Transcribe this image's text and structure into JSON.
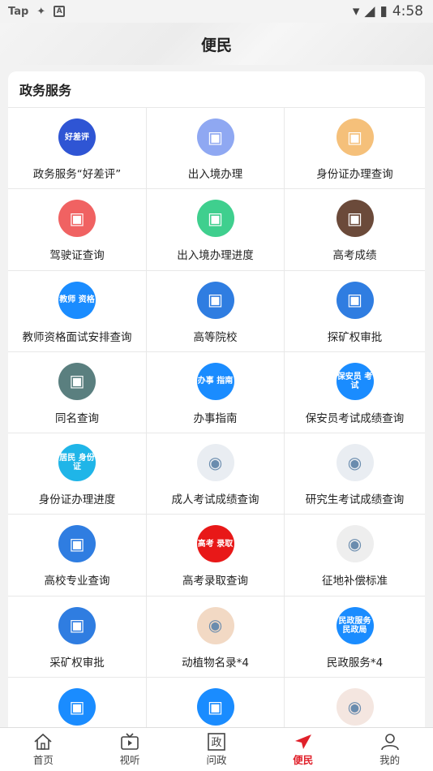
{
  "status_bar": {
    "app_label": "Tap",
    "time": "4:58"
  },
  "header": {
    "title": "便民"
  },
  "section": {
    "title": "政务服务"
  },
  "services": [
    {
      "label": "政务服务“好差评”",
      "icon": "rating-icon",
      "badge": "好差评",
      "color": "#2f55d4"
    },
    {
      "label": "出入境办理",
      "icon": "passport-icon",
      "badge": "",
      "color": "#8fa8f2"
    },
    {
      "label": "身份证办理查询",
      "icon": "id-card-icon",
      "badge": "",
      "color": "#f5c07a"
    },
    {
      "label": "驾驶证查询",
      "icon": "license-icon",
      "badge": "",
      "color": "#f06262"
    },
    {
      "label": "出入境办理进度",
      "icon": "plane-icon",
      "badge": "",
      "color": "#3fcf8e"
    },
    {
      "label": "高考成绩",
      "icon": "exam-score-icon",
      "badge": "",
      "color": "#6b4a3a"
    },
    {
      "label": "教师资格面试安排查询",
      "icon": "teacher-icon",
      "badge": "教师 资格",
      "color": "#1a8cff"
    },
    {
      "label": "高等院校",
      "icon": "university-icon",
      "badge": "",
      "color": "#2f7de1"
    },
    {
      "label": "探矿权审批",
      "icon": "mining-icon",
      "badge": "",
      "color": "#2f7de1"
    },
    {
      "label": "同名查询",
      "icon": "same-name-icon",
      "badge": "",
      "color": "#5a7f7f"
    },
    {
      "label": "办事指南",
      "icon": "guide-icon",
      "badge": "办事 指南",
      "color": "#1a8cff"
    },
    {
      "label": "保安员考试成绩查询",
      "icon": "security-guard-icon",
      "badge": "保安员 考试",
      "color": "#1a8cff"
    },
    {
      "label": "身份证办理进度",
      "icon": "id-progress-icon",
      "badge": "居民 身份证",
      "color": "#1fb5e8"
    },
    {
      "label": "成人考试成绩查询",
      "icon": "adult-exam-icon",
      "badge": "",
      "color": "#e9edf2"
    },
    {
      "label": "研究生考试成绩查询",
      "icon": "graduate-exam-icon",
      "badge": "",
      "color": "#e9edf2"
    },
    {
      "label": "高校专业查询",
      "icon": "major-icon",
      "badge": "",
      "color": "#2f7de1"
    },
    {
      "label": "高考录取查询",
      "icon": "admission-icon",
      "badge": "高考 录取",
      "color": "#e81818"
    },
    {
      "label": "征地补偿标准",
      "icon": "land-icon",
      "badge": "",
      "color": "#eeeeee"
    },
    {
      "label": "采矿权审批",
      "icon": "mining-right-icon",
      "badge": "",
      "color": "#2f7de1"
    },
    {
      "label": "动植物名录*4",
      "icon": "flora-fauna-icon",
      "badge": "",
      "color": "#f2d9c4"
    },
    {
      "label": "民政服务*4",
      "icon": "civil-affairs-icon",
      "badge": "民政服务 民政局",
      "color": "#1a8cff"
    },
    {
      "label": "",
      "icon": "service-icon-a",
      "badge": "",
      "color": "#1a8cff"
    },
    {
      "label": "",
      "icon": "service-icon-b",
      "badge": "",
      "color": "#1a8cff"
    },
    {
      "label": "",
      "icon": "growth-icon",
      "badge": "",
      "color": "#f4e6e0"
    }
  ],
  "tabbar": {
    "items": [
      {
        "label": "首页",
        "icon": "home-icon",
        "active": false
      },
      {
        "label": "视听",
        "icon": "tv-icon",
        "active": false
      },
      {
        "label": "问政",
        "icon": "politics-icon",
        "active": false
      },
      {
        "label": "便民",
        "icon": "send-icon",
        "active": true
      },
      {
        "label": "我的",
        "icon": "user-icon",
        "active": false
      }
    ]
  },
  "colors": {
    "accent": "#e0202a"
  }
}
